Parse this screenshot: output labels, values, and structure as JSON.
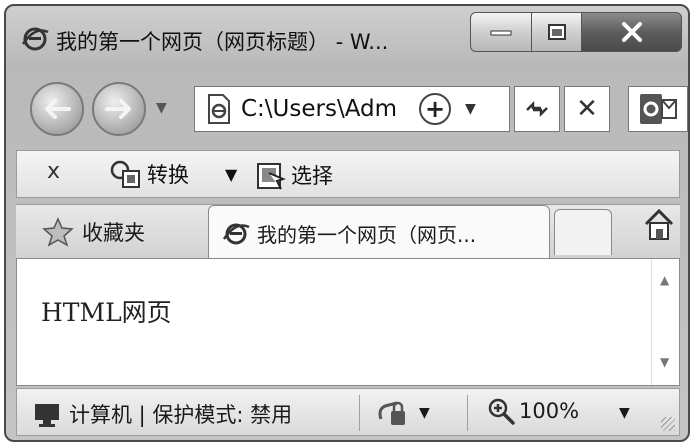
{
  "window": {
    "title": "我的第一个网页（网页标题） - W...",
    "controls": {
      "minimize": "—",
      "maximize": "☐",
      "close": "X"
    }
  },
  "nav": {
    "back_icon": "back-arrow-icon",
    "forward_icon": "forward-arrow-icon",
    "address": "C:\\Users\\Adm",
    "refresh_icon": "refresh-icon",
    "stop_label": "✕"
  },
  "toolbar": {
    "close_label": "x",
    "convert_label": "转换",
    "select_label": "选择"
  },
  "tabs": {
    "favorites_label": "收藏夹",
    "active_tab_label": "我的第一个网页（网页..."
  },
  "page": {
    "body_text": "HTML网页"
  },
  "status": {
    "zone_label": "计算机 | 保护模式: 禁用",
    "zoom_label": "100%"
  }
}
